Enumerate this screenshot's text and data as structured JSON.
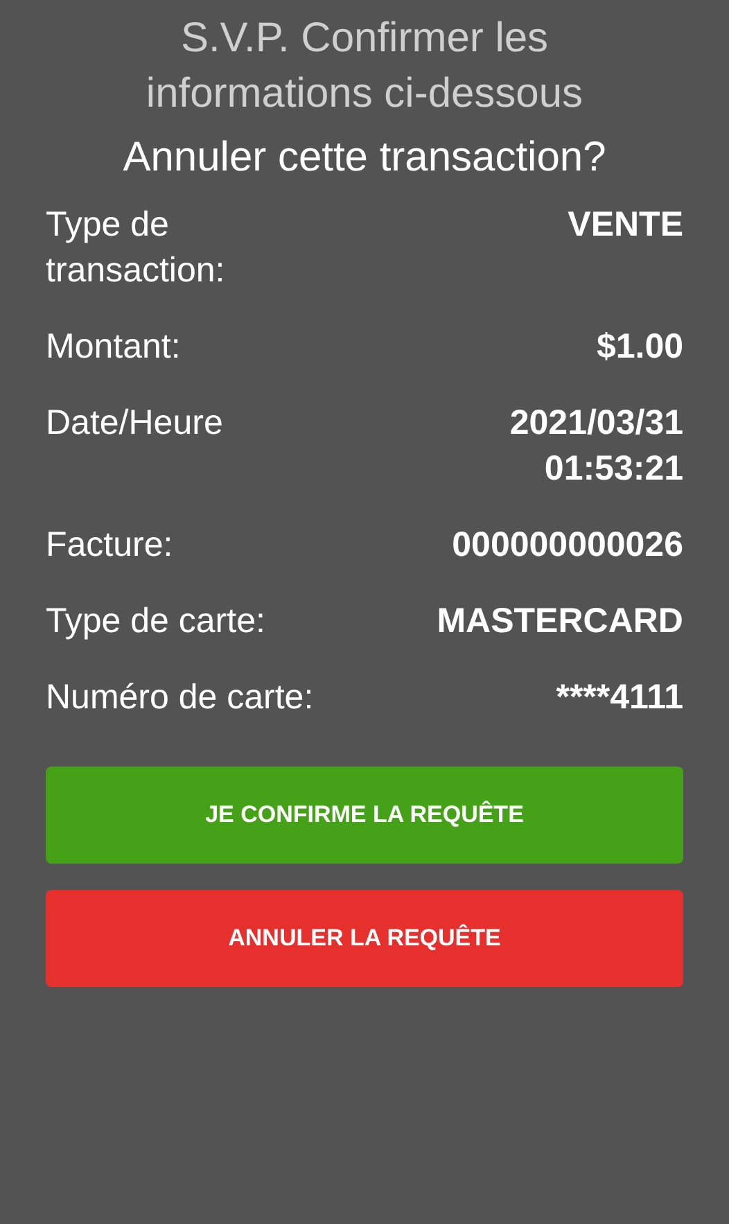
{
  "header": {
    "title": "S.V.P. Confirmer les informations ci-dessous",
    "question": "Annuler cette transaction?"
  },
  "details": [
    {
      "label": "Type de transaction:",
      "value": "VENTE"
    },
    {
      "label": "Montant:",
      "value": "$1.00"
    },
    {
      "label": "Date/Heure",
      "value": "2021/03/31 01:53:21"
    },
    {
      "label": "Facture:",
      "value": "000000000026"
    },
    {
      "label": "Type de carte:",
      "value": "MASTERCARD"
    },
    {
      "label": "Numéro de carte:",
      "value": "****4111"
    }
  ],
  "buttons": [
    {
      "label": "JE CONFIRME LA REQUÊTE",
      "kind": "confirm"
    },
    {
      "label": "ANNULER LA REQUÊTE",
      "kind": "cancel"
    }
  ]
}
